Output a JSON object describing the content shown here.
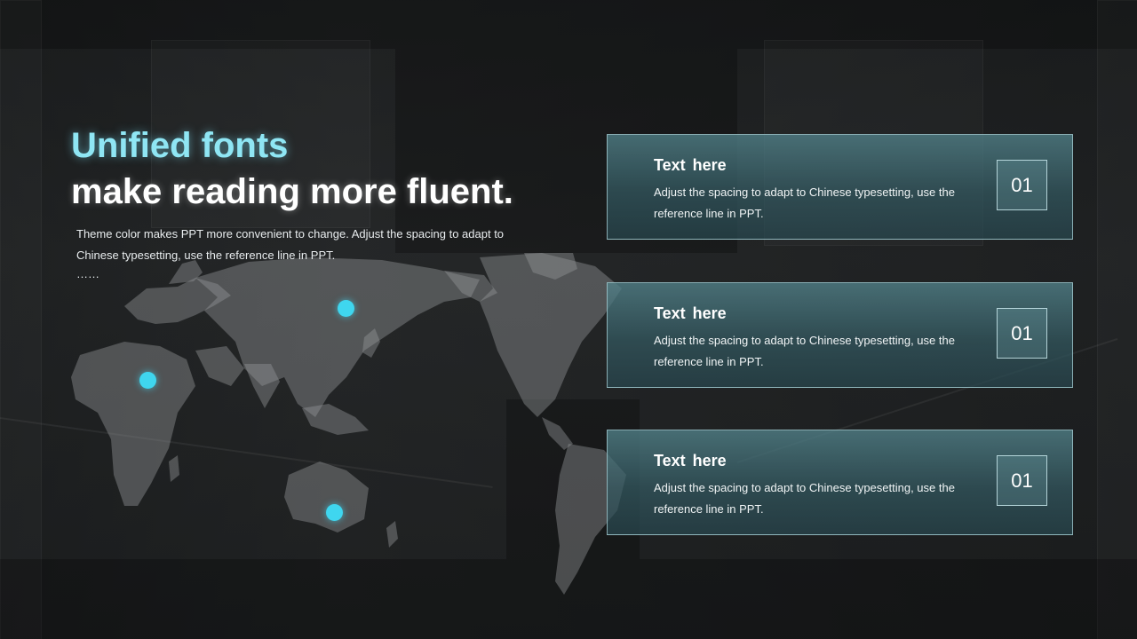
{
  "heading": {
    "accent": "Unified fonts",
    "main": "make reading more fluent."
  },
  "intro": {
    "text": "Theme color makes PPT more convenient  to change. Adjust the spacing to adapt to Chinese  typesetting, use the reference line in PPT.",
    "ellipsis": "……"
  },
  "cards": [
    {
      "title": "Text  here",
      "description": "Adjust the spacing to adapt to Chinese  typesetting, use the reference line in PPT.",
      "number": "01"
    },
    {
      "title": "Text  here",
      "description": "Adjust the spacing to adapt to Chinese  typesetting, use the reference line in PPT.",
      "number": "01"
    },
    {
      "title": "Text  here",
      "description": "Adjust the spacing to adapt to Chinese  typesetting, use the reference line in PPT.",
      "number": "01"
    }
  ],
  "colors": {
    "accent": "#8fe6f4",
    "marker": "#3fd6ef",
    "card": "#4f848c"
  },
  "icons": {
    "map": "world-map-icon",
    "marker": "location-dot-icon"
  }
}
